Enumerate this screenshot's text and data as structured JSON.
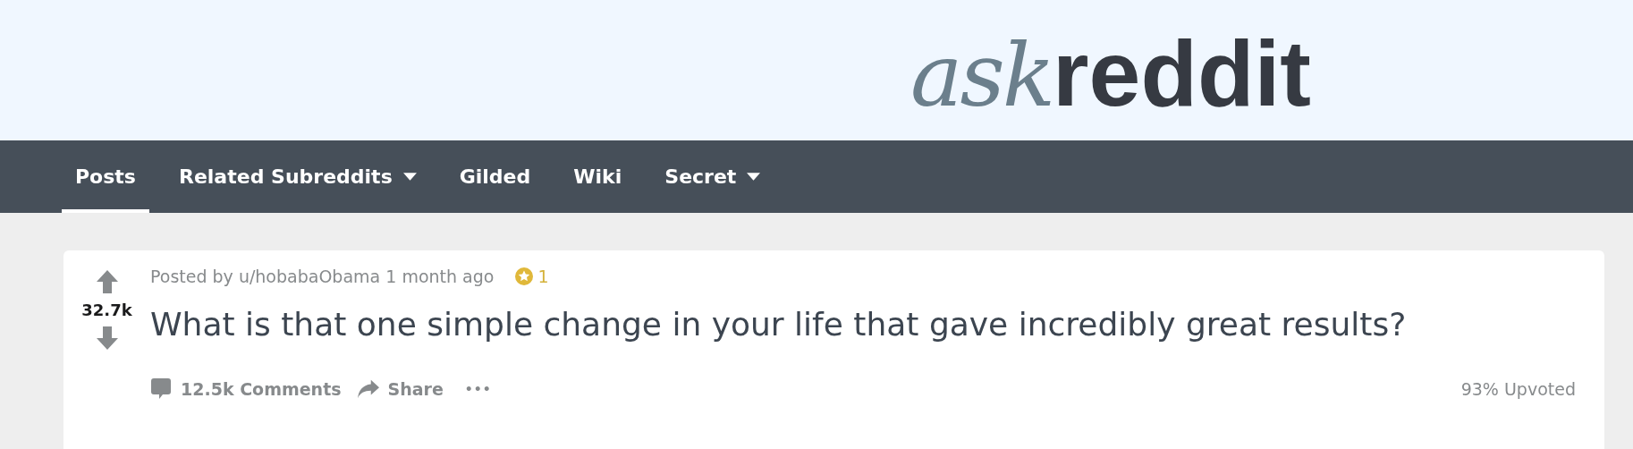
{
  "header": {
    "logo": {
      "prefix": "ask",
      "name": "reddit"
    }
  },
  "tabs": [
    {
      "label": "Posts",
      "selected": true,
      "dropdown": false
    },
    {
      "label": "Related Subreddits",
      "selected": false,
      "dropdown": true
    },
    {
      "label": "Gilded",
      "selected": false,
      "dropdown": false
    },
    {
      "label": "Wiki",
      "selected": false,
      "dropdown": false
    },
    {
      "label": "Secret",
      "selected": false,
      "dropdown": true
    }
  ],
  "post": {
    "score": "32.7k",
    "posted_by": "Posted by u/hobabaObama 1 month ago",
    "awards": "1",
    "title": "What is that one simple change in your life that gave incredibly great results?",
    "comments": "12.5k Comments",
    "share": "Share",
    "more": "•••",
    "upvoted": "93% Upvoted"
  }
}
